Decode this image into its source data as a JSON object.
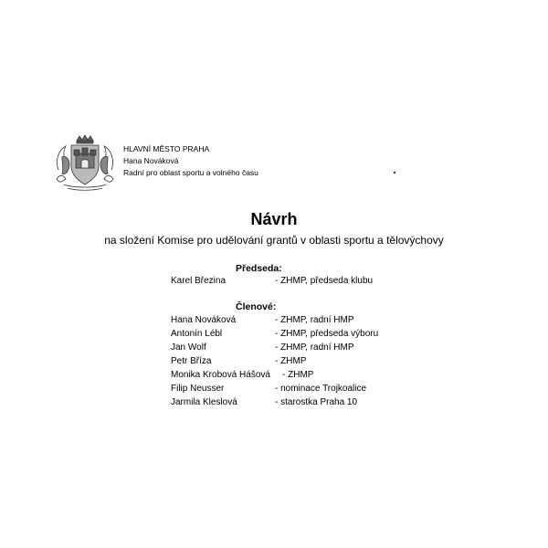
{
  "letterhead": {
    "line1": "HLAVNÍ MĚSTO PRAHA",
    "line2": "Hana Nováková",
    "line3": "Radní pro oblast sportu a volného času"
  },
  "document": {
    "title": "Návrh",
    "subtitle": "na složení Komise pro udělování grantů v oblasti sportu a tělovýchovy"
  },
  "chair": {
    "heading": "Předseda:",
    "members": [
      {
        "name": "Karel Březina",
        "role": "- ZHMP, předseda klubu"
      }
    ]
  },
  "members": {
    "heading": "Členové:",
    "items": [
      {
        "name": "Hana Nováková",
        "role": "- ZHMP, radní HMP"
      },
      {
        "name": "Antonín Lébl",
        "role": "- ZHMP, předseda výboru"
      },
      {
        "name": "Jan Wolf",
        "role": "- ZHMP, radní HMP"
      },
      {
        "name": "Petr Bříza",
        "role": "- ZHMP"
      },
      {
        "name": "Monika Krobová Hášová",
        "role": "- ZHMP"
      },
      {
        "name": "Filip Neusser",
        "role": "- nominace Trojkoalice"
      },
      {
        "name": "Jarmila Kleslová",
        "role": "- starostka Praha 10"
      }
    ]
  }
}
